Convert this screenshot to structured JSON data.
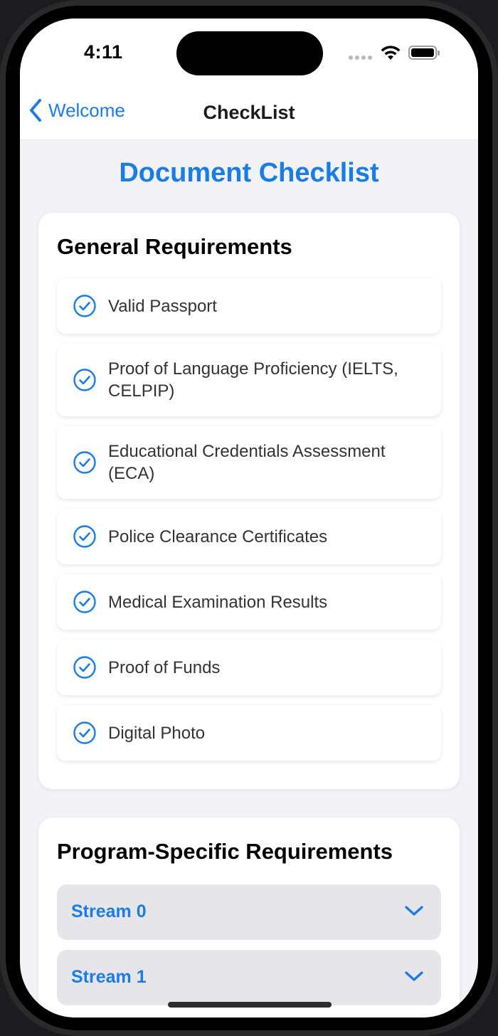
{
  "status_bar": {
    "time": "4:11"
  },
  "nav": {
    "back_label": "Welcome",
    "title": "CheckList"
  },
  "page_title": "Document Checklist",
  "general": {
    "title": "General Requirements",
    "items": [
      {
        "label": "Valid Passport"
      },
      {
        "label": "Proof of Language Proficiency (IELTS, CELPIP)"
      },
      {
        "label": "Educational Credentials Assessment (ECA)"
      },
      {
        "label": "Police Clearance Certificates"
      },
      {
        "label": "Medical Examination Results"
      },
      {
        "label": "Proof of Funds"
      },
      {
        "label": "Digital Photo"
      }
    ]
  },
  "program": {
    "title": "Program-Specific Requirements",
    "streams": [
      {
        "label": "Stream 0"
      },
      {
        "label": "Stream 1"
      }
    ]
  },
  "colors": {
    "accent": "#1a7ce6",
    "background": "#f2f2f7",
    "card": "#ffffff",
    "stream_bg": "#e6e6ea"
  },
  "icons": {
    "back": "chevron-left-icon",
    "check": "checkmark-circle-icon",
    "expand": "chevron-down-icon"
  }
}
